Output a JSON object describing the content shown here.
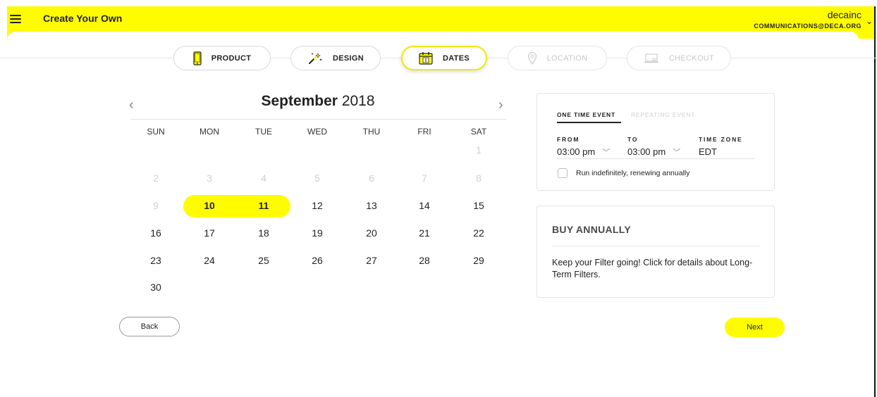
{
  "header": {
    "title": "Create Your Own",
    "account_name": "decainc",
    "account_email": "COMMUNICATIONS@DECA.ORG",
    "menu_icon": "hamburger-menu-icon",
    "bar_color": "#fffc00"
  },
  "steps": [
    {
      "label": "PRODUCT",
      "icon": "phone-icon",
      "state": "complete"
    },
    {
      "label": "DESIGN",
      "icon": "magic-wand-icon",
      "state": "complete"
    },
    {
      "label": "DATES",
      "icon": "calendar-icon",
      "state": "active"
    },
    {
      "label": "LOCATION",
      "icon": "location-pin-icon",
      "state": "disabled"
    },
    {
      "label": "CHECKOUT",
      "icon": "laptop-icon",
      "state": "disabled"
    }
  ],
  "calendar": {
    "month": "September",
    "year": "2018",
    "weekdays": [
      "SUN",
      "MON",
      "TUE",
      "WED",
      "THU",
      "FRI",
      "SAT"
    ],
    "weeks": [
      [
        "",
        "",
        "",
        "",
        "",
        "",
        "1"
      ],
      [
        "2",
        "3",
        "4",
        "5",
        "6",
        "7",
        "8"
      ],
      [
        "9",
        "10",
        "11",
        "12",
        "13",
        "14",
        "15"
      ],
      [
        "16",
        "17",
        "18",
        "19",
        "20",
        "21",
        "22"
      ],
      [
        "23",
        "24",
        "25",
        "26",
        "27",
        "28",
        "29"
      ],
      [
        "30",
        "",
        "",
        "",
        "",
        "",
        ""
      ]
    ],
    "disabled_days": [
      "1",
      "2",
      "3",
      "4",
      "5",
      "6",
      "7",
      "8",
      "9"
    ],
    "selected_days": [
      "10",
      "11"
    ]
  },
  "event": {
    "tab_one": "ONE TIME EVENT",
    "tab_repeat": "REPEATING EVENT",
    "from_label": "FROM",
    "from_value": "03:00 pm",
    "to_label": "TO",
    "to_value": "03:00 pm",
    "timezone_label": "TIME ZONE",
    "timezone_value": "EDT",
    "checkbox_label": "Run indefinitely, renewing annually",
    "checkbox_checked": false
  },
  "buy": {
    "title": "BUY ANNUALLY",
    "text": "Keep your Filter going! Click for details about Long-Term Filters."
  },
  "buttons": {
    "back": "Back",
    "next": "Next"
  }
}
